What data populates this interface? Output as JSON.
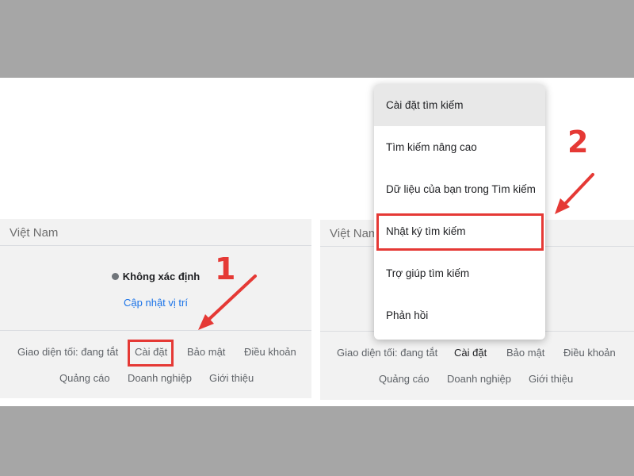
{
  "left_panel": {
    "country": "Việt Nam",
    "location_status": "Không xác định",
    "update_location": "Cập nhật vị trí",
    "footer_row1": [
      "Giao diện tối: đang tắt",
      "Cài đặt",
      "Bảo mật",
      "Điều khoản"
    ],
    "footer_row2": [
      "Quảng cáo",
      "Doanh nghiệp",
      "Giới thiệu"
    ]
  },
  "right_panel": {
    "country": "Việt Nam",
    "footer_row1": [
      "Giao diện tối: đang tắt",
      "Cài đặt",
      "Bảo mật",
      "Điều khoản"
    ],
    "footer_row2": [
      "Quảng cáo",
      "Doanh nghiệp",
      "Giới thiệu"
    ]
  },
  "settings_menu": {
    "items": [
      "Cài đặt tìm kiếm",
      "Tìm kiếm nâng cao",
      "Dữ liệu của bạn trong Tìm kiếm",
      "Nhật ký tìm kiếm",
      "Trợ giúp tìm kiếm",
      "Phản hồi"
    ]
  },
  "annotations": {
    "step1": "1",
    "step2": "2",
    "highlight_color": "#e53935"
  }
}
